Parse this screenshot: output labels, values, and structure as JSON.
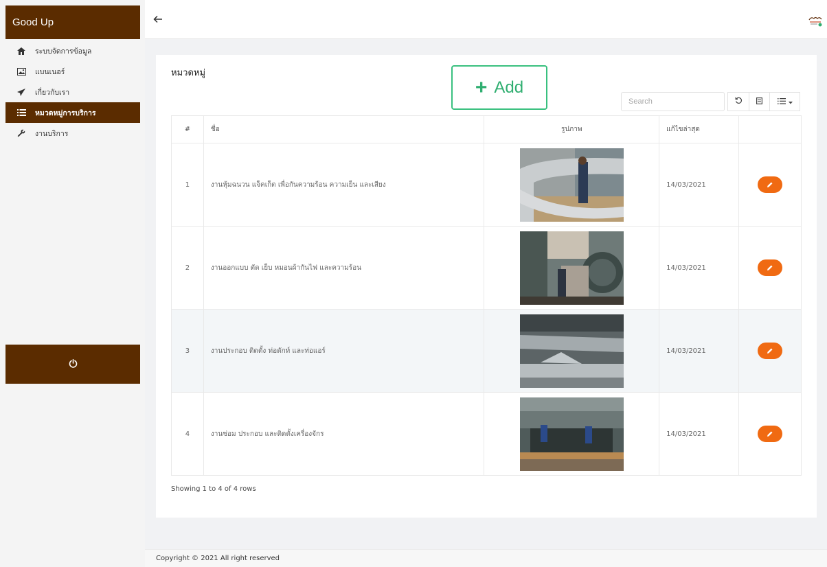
{
  "brand": {
    "title": "Good Up"
  },
  "sidebar": {
    "items": [
      {
        "label": "ระบบจัดการข้อมูล",
        "icon": "home-icon",
        "active": false
      },
      {
        "label": "แบนเนอร์",
        "icon": "image-icon",
        "active": false
      },
      {
        "label": "เกี่ยวกับเรา",
        "icon": "send-icon",
        "active": false
      },
      {
        "label": "หมวดหมู่การบริการ",
        "icon": "list-icon",
        "active": true
      },
      {
        "label": "งานบริการ",
        "icon": "wrench-icon",
        "active": false
      }
    ],
    "logout_icon": "power-icon"
  },
  "page": {
    "title": "หมวดหมู่",
    "add_label": "Add",
    "search_placeholder": "Search"
  },
  "table": {
    "headers": [
      "#",
      "ชื่อ",
      "รูปภาพ",
      "แก้ไขล่าสุด",
      ""
    ],
    "rows": [
      {
        "num": "1",
        "name": "งานหุ้มฉนวน แจ็คเก็ต เพื่อกันความร้อน ความเย็น และเสียง",
        "date": "14/03/2021"
      },
      {
        "num": "2",
        "name": "งานออกแบบ ตัด เย็บ หมอนผ้ากันไฟ และความร้อน",
        "date": "14/03/2021"
      },
      {
        "num": "3",
        "name": "งานประกอบ ติดตั้ง ท่อดักท์ และท่อแอร์",
        "date": "14/03/2021"
      },
      {
        "num": "4",
        "name": "งานซ่อม ประกอบ และติดตั้งเครื่องจักร",
        "date": "14/03/2021"
      }
    ],
    "summary": "Showing 1 to 4 of 4 rows"
  },
  "footer": {
    "text": "Copyright © 2021 All right reserved"
  },
  "colors": {
    "brand": "#5b2c00",
    "accent": "#f06a12",
    "add": "#39c07f"
  }
}
